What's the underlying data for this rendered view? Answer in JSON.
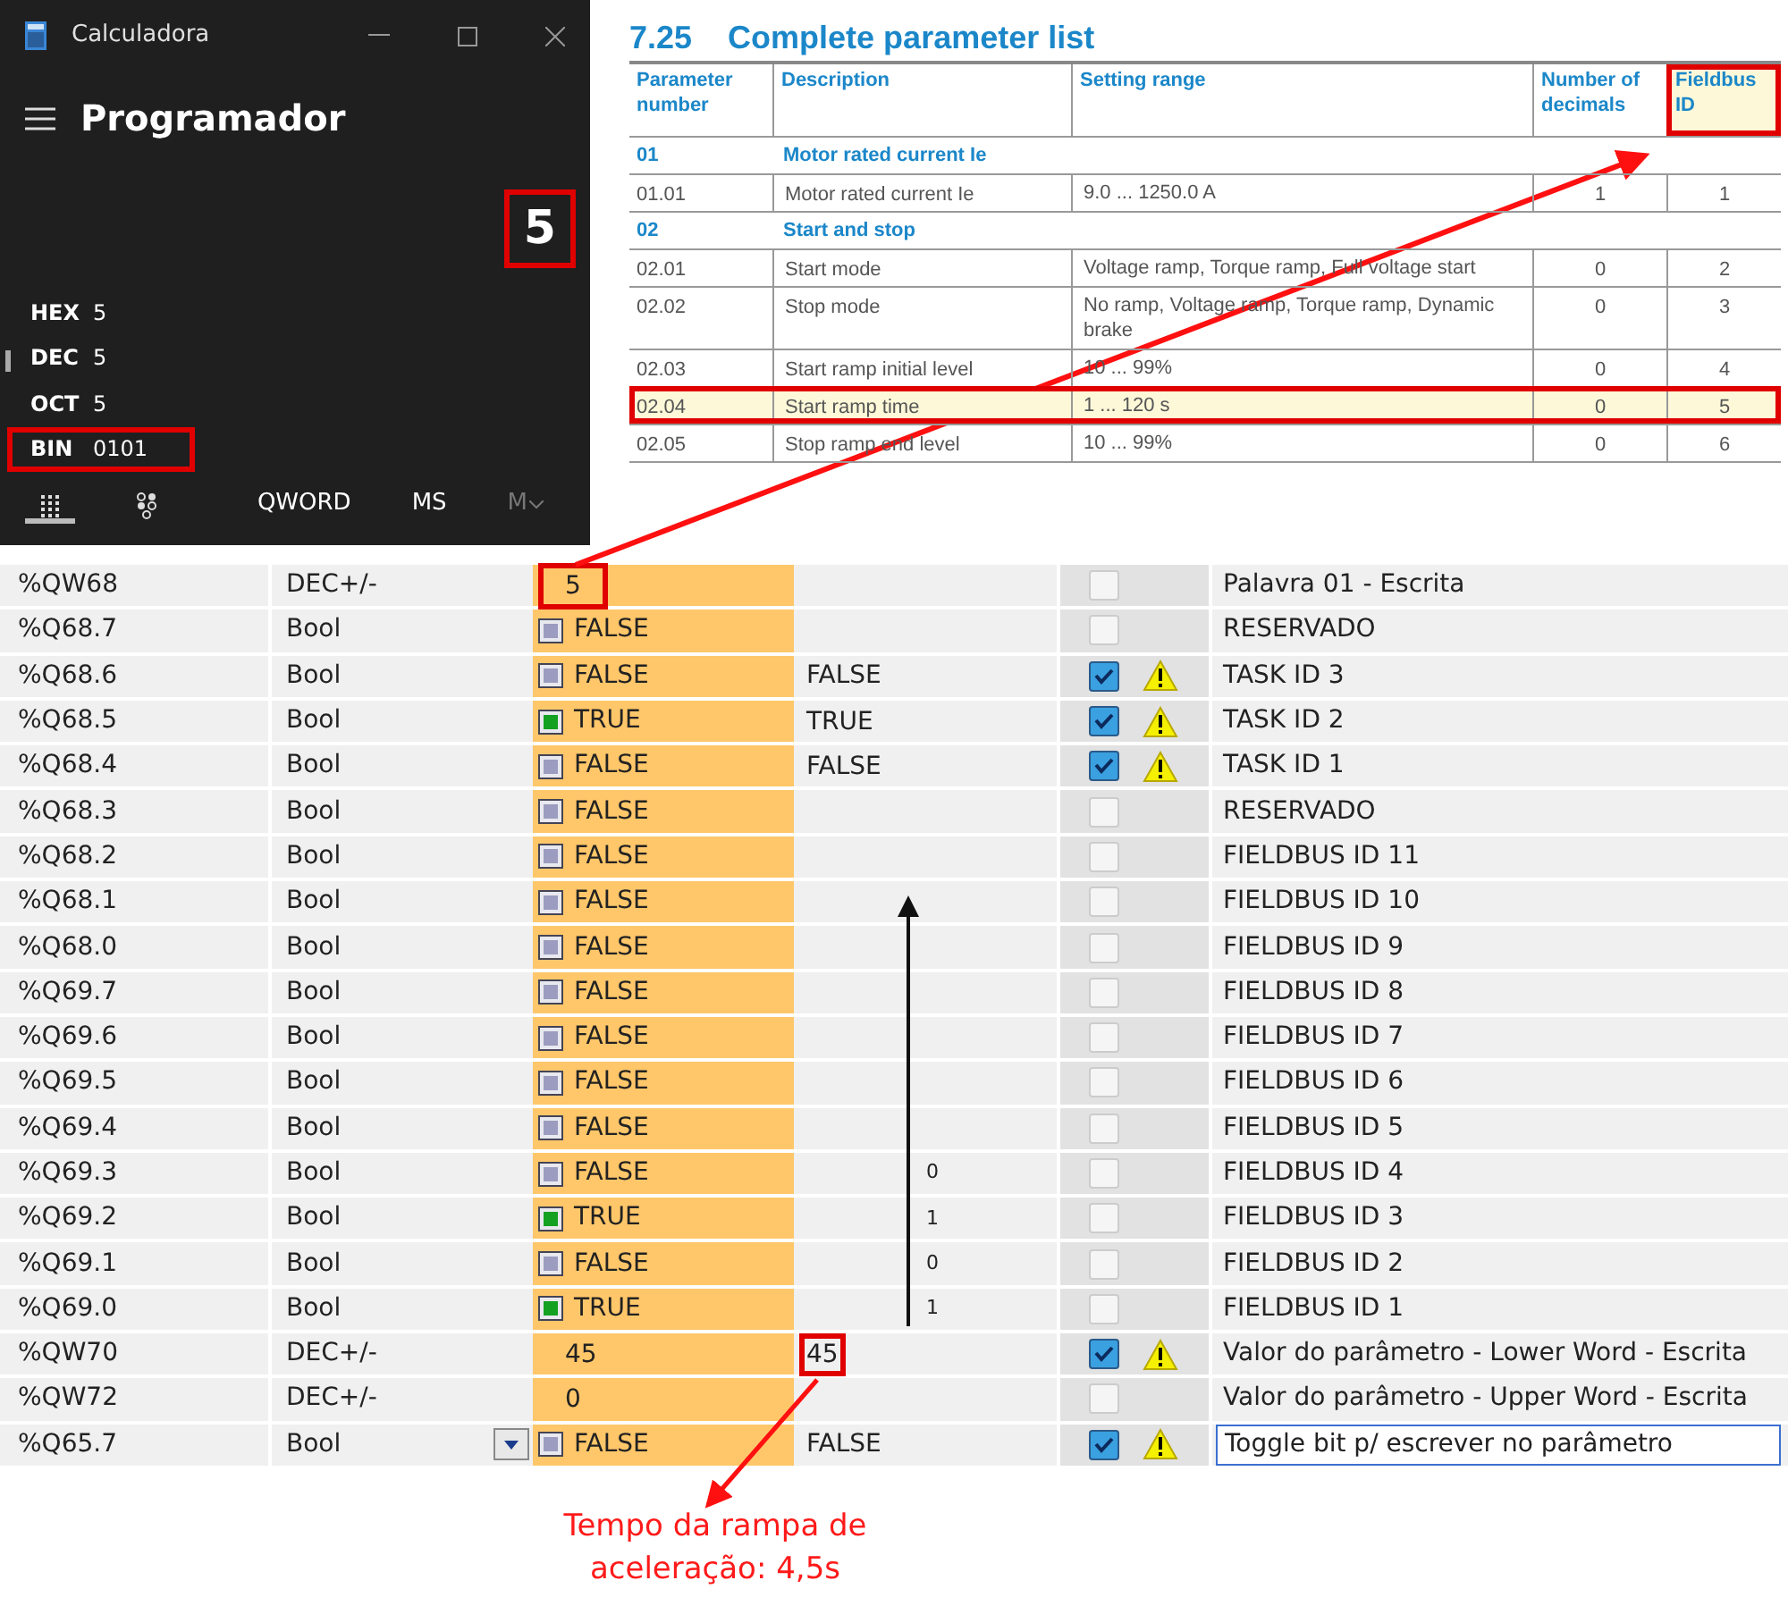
{
  "calculator": {
    "title": "Calculadora",
    "mode": "Programador",
    "display": "5",
    "display_highlighted": true,
    "bases": [
      {
        "label": "HEX",
        "value": "5",
        "selected": false,
        "highlighted": false
      },
      {
        "label": "DEC",
        "value": "5",
        "selected": true,
        "highlighted": false
      },
      {
        "label": "OCT",
        "value": "5",
        "selected": false,
        "highlighted": false
      },
      {
        "label": "BIN",
        "value": "0101",
        "selected": false,
        "highlighted": true
      }
    ],
    "footer_tabs": [
      {
        "selected": true
      },
      {
        "selected": false
      }
    ],
    "footer_buttons": [
      {
        "label": "QWORD",
        "disabled": false
      },
      {
        "label": "MS",
        "disabled": false
      },
      {
        "label": "M",
        "disabled": true
      }
    ]
  },
  "parameter_list": {
    "section_number": "7.25",
    "title": "Complete parameter list",
    "columns": [
      {
        "label": "Parameter number",
        "highlighted": false
      },
      {
        "label": "Description",
        "highlighted": false
      },
      {
        "label": "Setting range",
        "highlighted": false
      },
      {
        "label": "Number of decimals",
        "highlighted": false
      },
      {
        "label": "Fieldbus ID",
        "highlighted": true
      }
    ],
    "rows": [
      {
        "kind": "group",
        "number": "01",
        "description": "Motor rated current Ie"
      },
      {
        "kind": "param",
        "number": "01.01",
        "description": "Motor rated current Ie",
        "range": "9.0 ... 1250.0 A",
        "decimals": "1",
        "fieldbus_id": "1",
        "highlighted": false
      },
      {
        "kind": "group",
        "number": "02",
        "description": "Start and stop"
      },
      {
        "kind": "param",
        "number": "02.01",
        "description": "Start mode",
        "range": "Voltage ramp, Torque ramp, Full voltage start",
        "decimals": "0",
        "fieldbus_id": "2",
        "highlighted": false
      },
      {
        "kind": "param",
        "number": "02.02",
        "description": "Stop mode",
        "range": "No ramp, Voltage ramp, Torque ramp, Dynamic brake",
        "decimals": "0",
        "fieldbus_id": "3",
        "highlighted": false
      },
      {
        "kind": "param",
        "number": "02.03",
        "description": "Start ramp initial level",
        "range": "10 ... 99%",
        "decimals": "0",
        "fieldbus_id": "4",
        "highlighted": false
      },
      {
        "kind": "param",
        "number": "02.04",
        "description": "Start ramp time",
        "range": "1 ... 120 s",
        "decimals": "0",
        "fieldbus_id": "5",
        "highlighted": true
      },
      {
        "kind": "param",
        "number": "02.05",
        "description": "Stop ramp end level",
        "range": "10 ... 99%",
        "decimals": "0",
        "fieldbus_id": "6",
        "highlighted": false
      }
    ]
  },
  "watch_table": {
    "rows": [
      {
        "address": "%QW68",
        "type": "DEC+/-",
        "monitor": {
          "kind": "number",
          "value": "5",
          "highlighted": true
        },
        "modify_enabled": false,
        "warning": false,
        "comment": "Palavra 01 - Escrita"
      },
      {
        "address": "%Q68.7",
        "type": "Bool",
        "monitor": {
          "kind": "bool",
          "value": "FALSE",
          "on": false
        },
        "modify_enabled": false,
        "warning": false,
        "comment": "RESERVADO"
      },
      {
        "address": "%Q68.6",
        "type": "Bool",
        "monitor": {
          "kind": "bool",
          "value": "FALSE",
          "on": false
        },
        "modify_value": "FALSE",
        "modify_enabled": true,
        "warning": true,
        "comment": "TASK ID 3"
      },
      {
        "address": "%Q68.5",
        "type": "Bool",
        "monitor": {
          "kind": "bool",
          "value": "TRUE",
          "on": true
        },
        "modify_value": "TRUE",
        "modify_enabled": true,
        "warning": true,
        "comment": "TASK ID 2"
      },
      {
        "address": "%Q68.4",
        "type": "Bool",
        "monitor": {
          "kind": "bool",
          "value": "FALSE",
          "on": false
        },
        "modify_value": "FALSE",
        "modify_enabled": true,
        "warning": true,
        "comment": "TASK ID 1"
      },
      {
        "address": "%Q68.3",
        "type": "Bool",
        "monitor": {
          "kind": "bool",
          "value": "FALSE",
          "on": false
        },
        "modify_enabled": false,
        "warning": false,
        "comment": "RESERVADO"
      },
      {
        "address": "%Q68.2",
        "type": "Bool",
        "monitor": {
          "kind": "bool",
          "value": "FALSE",
          "on": false
        },
        "modify_enabled": false,
        "warning": false,
        "comment": "FIELDBUS ID 11"
      },
      {
        "address": "%Q68.1",
        "type": "Bool",
        "monitor": {
          "kind": "bool",
          "value": "FALSE",
          "on": false
        },
        "modify_enabled": false,
        "warning": false,
        "comment": "FIELDBUS ID 10"
      },
      {
        "address": "%Q68.0",
        "type": "Bool",
        "monitor": {
          "kind": "bool",
          "value": "FALSE",
          "on": false
        },
        "modify_enabled": false,
        "warning": false,
        "comment": "FIELDBUS ID 9"
      },
      {
        "address": "%Q69.7",
        "type": "Bool",
        "monitor": {
          "kind": "bool",
          "value": "FALSE",
          "on": false
        },
        "modify_enabled": false,
        "warning": false,
        "comment": "FIELDBUS ID 8"
      },
      {
        "address": "%Q69.6",
        "type": "Bool",
        "monitor": {
          "kind": "bool",
          "value": "FALSE",
          "on": false
        },
        "modify_enabled": false,
        "warning": false,
        "comment": "FIELDBUS ID 7"
      },
      {
        "address": "%Q69.5",
        "type": "Bool",
        "monitor": {
          "kind": "bool",
          "value": "FALSE",
          "on": false
        },
        "modify_enabled": false,
        "warning": false,
        "comment": "FIELDBUS ID 6"
      },
      {
        "address": "%Q69.4",
        "type": "Bool",
        "monitor": {
          "kind": "bool",
          "value": "FALSE",
          "on": false
        },
        "modify_enabled": false,
        "warning": false,
        "comment": "FIELDBUS ID 5"
      },
      {
        "address": "%Q69.3",
        "type": "Bool",
        "monitor": {
          "kind": "bool",
          "value": "FALSE",
          "on": false
        },
        "bit": "0",
        "modify_enabled": false,
        "warning": false,
        "comment": "FIELDBUS ID 4"
      },
      {
        "address": "%Q69.2",
        "type": "Bool",
        "monitor": {
          "kind": "bool",
          "value": "TRUE",
          "on": true
        },
        "bit": "1",
        "modify_enabled": false,
        "warning": false,
        "comment": "FIELDBUS ID 3"
      },
      {
        "address": "%Q69.1",
        "type": "Bool",
        "monitor": {
          "kind": "bool",
          "value": "FALSE",
          "on": false
        },
        "bit": "0",
        "modify_enabled": false,
        "warning": false,
        "comment": "FIELDBUS ID 2"
      },
      {
        "address": "%Q69.0",
        "type": "Bool",
        "monitor": {
          "kind": "bool",
          "value": "TRUE",
          "on": true
        },
        "bit": "1",
        "modify_enabled": false,
        "warning": false,
        "comment": "FIELDBUS ID 1"
      },
      {
        "address": "%QW70",
        "type": "DEC+/-",
        "monitor": {
          "kind": "number",
          "value": "45",
          "highlighted": false
        },
        "modify_value": "45",
        "modify_highlighted": true,
        "modify_enabled": true,
        "warning": true,
        "comment": "Valor do parâmetro - Lower Word - Escrita"
      },
      {
        "address": "%QW72",
        "type": "DEC+/-",
        "monitor": {
          "kind": "number",
          "value": "0",
          "highlighted": false
        },
        "modify_enabled": false,
        "warning": false,
        "comment": "Valor do parâmetro - Upper Word - Escrita"
      },
      {
        "address": "%Q65.7",
        "type": "Bool",
        "has_dropdown": true,
        "monitor": {
          "kind": "bool",
          "value": "FALSE",
          "on": false
        },
        "modify_value": "FALSE",
        "modify_enabled": true,
        "warning": true,
        "comment": "Toggle bit p/ escrever no parâmetro",
        "comment_editing": true
      }
    ]
  },
  "annotation": "Tempo da rampa de aceleração: 4,5s"
}
